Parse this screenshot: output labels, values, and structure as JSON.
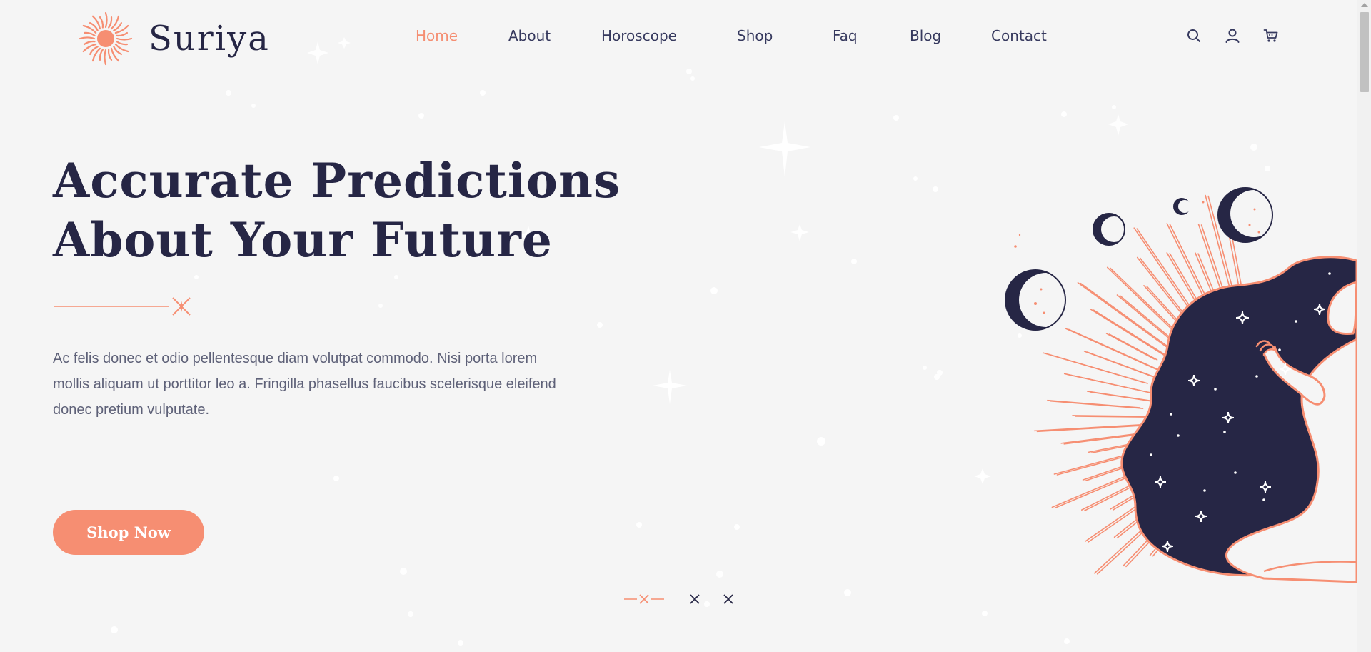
{
  "brand": {
    "name": "Suriya",
    "accent": "#f68e72",
    "navy": "#262645",
    "background": "#f5f5f5"
  },
  "nav": {
    "items": [
      {
        "label": "Home",
        "active": true
      },
      {
        "label": "About",
        "active": false
      },
      {
        "label": "Horoscope",
        "active": false
      },
      {
        "label": "Shop",
        "active": false
      },
      {
        "label": "Faq",
        "active": false
      },
      {
        "label": "Blog",
        "active": false
      },
      {
        "label": "Contact",
        "active": false
      }
    ]
  },
  "header_icons": [
    "search-icon",
    "user-icon",
    "cart-icon"
  ],
  "hero": {
    "title_line1": "Accurate Predictions",
    "title_line2": "About Your Future",
    "description": "Ac felis donec et odio pellentesque diam volutpat commodo. Nisi porta lorem mollis aliquam ut porttitor leo a. Fringilla phasellus faucibus scelerisque eleifend donec pretium vulputate.",
    "cta_label": "Shop Now"
  },
  "slider": {
    "count": 3,
    "active_index": 0
  }
}
